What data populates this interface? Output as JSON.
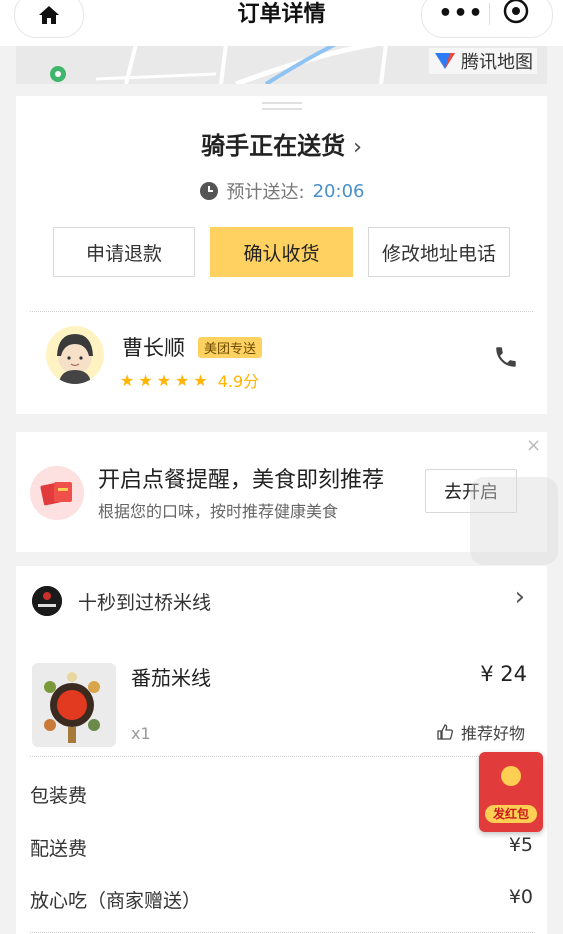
{
  "nav": {
    "title": "订单详情",
    "more": "•••"
  },
  "map": {
    "logo_text": "腾讯地图"
  },
  "status": {
    "headline": "骑手正在送货",
    "eta_label": "预计送达:",
    "eta_time": "20:06",
    "buttons": [
      "申请退款",
      "确认收货",
      "修改地址电话"
    ]
  },
  "rider": {
    "name": "曹长顺",
    "badge": "美团专送",
    "rating": "4.9分",
    "stars": 5
  },
  "reminder": {
    "title": "开启点餐提醒，美食即刻推荐",
    "subtitle": "根据您的口味，按时推荐健康美食",
    "button": "去开启",
    "close": "×"
  },
  "order": {
    "shop_name": "十秒到过桥米线",
    "item": {
      "name": "番茄米线",
      "price": "¥ 24",
      "qty": "x1",
      "recommend": "推荐好物"
    },
    "fees": [
      {
        "label": "包装费",
        "value": ""
      },
      {
        "label": "配送费",
        "value": "¥5"
      },
      {
        "label": "放心吃（商家赠送）",
        "value": "¥0"
      }
    ]
  },
  "redpacket": {
    "label": "发红包"
  },
  "colors": {
    "accent": "#ffd161",
    "eta": "#4a90c9",
    "star": "#ffb400",
    "red": "#e23b3b"
  }
}
